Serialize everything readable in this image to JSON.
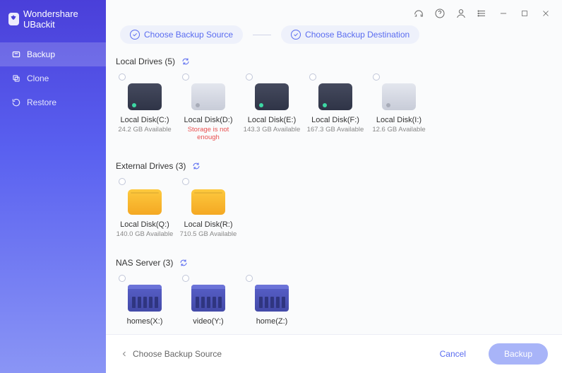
{
  "brand": {
    "name": "Wondershare UBackit"
  },
  "nav": {
    "items": [
      {
        "label": "Backup",
        "icon": "backup-icon",
        "active": true
      },
      {
        "label": "Clone",
        "icon": "clone-icon",
        "active": false
      },
      {
        "label": "Restore",
        "icon": "restore-icon",
        "active": false
      }
    ]
  },
  "steps": {
    "source": "Choose Backup Source",
    "destination": "Choose Backup Destination"
  },
  "sections": {
    "local": {
      "title": "Local Drives (5)"
    },
    "external": {
      "title": "External Drives (3)"
    },
    "nas": {
      "title": "NAS Server (3)"
    }
  },
  "localDrives": [
    {
      "label": "Local Disk(C:)",
      "sub": "24.2 GB Available",
      "variant": "dark",
      "error": false
    },
    {
      "label": "Local Disk(D:)",
      "sub": "Storage is not enough",
      "variant": "light",
      "error": true
    },
    {
      "label": "Local Disk(E:)",
      "sub": "143.3 GB Available",
      "variant": "dark",
      "error": false
    },
    {
      "label": "Local Disk(F:)",
      "sub": "167.3 GB Available",
      "variant": "dark",
      "error": false
    },
    {
      "label": "Local Disk(I:)",
      "sub": "12.6 GB Available",
      "variant": "light",
      "error": false
    }
  ],
  "externalDrives": [
    {
      "label": "Local Disk(Q:)",
      "sub": "140.0 GB Available"
    },
    {
      "label": "Local Disk(R:)",
      "sub": "710.5 GB Available"
    }
  ],
  "nasServers": [
    {
      "label": "homes(X:)"
    },
    {
      "label": "video(Y:)"
    },
    {
      "label": "home(Z:)"
    }
  ],
  "footer": {
    "hint": "Choose Backup Source",
    "cancel": "Cancel",
    "backup": "Backup"
  }
}
